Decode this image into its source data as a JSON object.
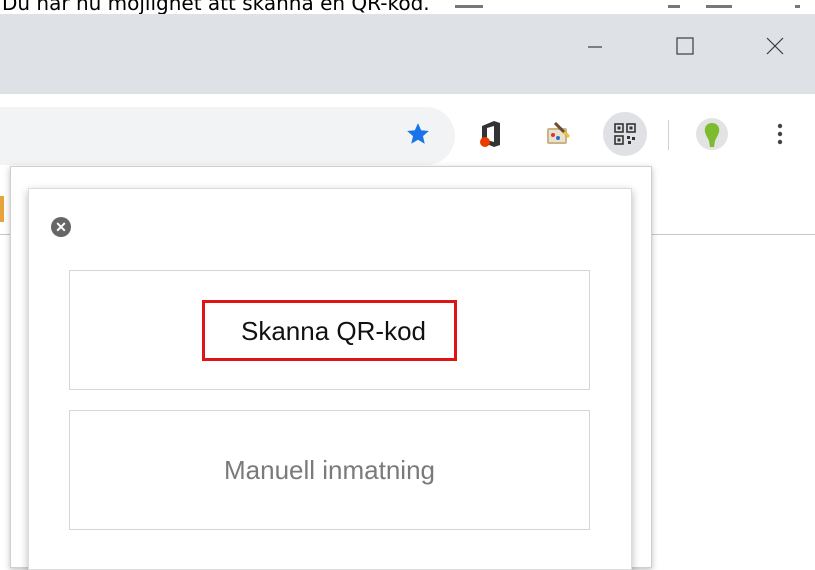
{
  "document": {
    "caption": "Du har nu möjlighet att skanna en QR-kod."
  },
  "window": {
    "controls": {
      "minimize_icon": "minimize-icon",
      "maximize_icon": "maximize-icon",
      "close_icon": "close-icon"
    }
  },
  "toolbar": {
    "icons": [
      "star-icon",
      "office-icon",
      "paint-extension-icon",
      "qr-scanner-extension-icon",
      "profile-avatar-icon",
      "menu-kebab-icon"
    ],
    "star_color": "#1a73e8",
    "office_color": "#eb3c00",
    "avatar_color": "#7dbb2f"
  },
  "popup": {
    "close_icon": "close-circle-icon",
    "scan_button_label": "Skanna QR-kod",
    "manual_button_label": "Manuell inmatning",
    "highlight_color": "#e01414"
  }
}
